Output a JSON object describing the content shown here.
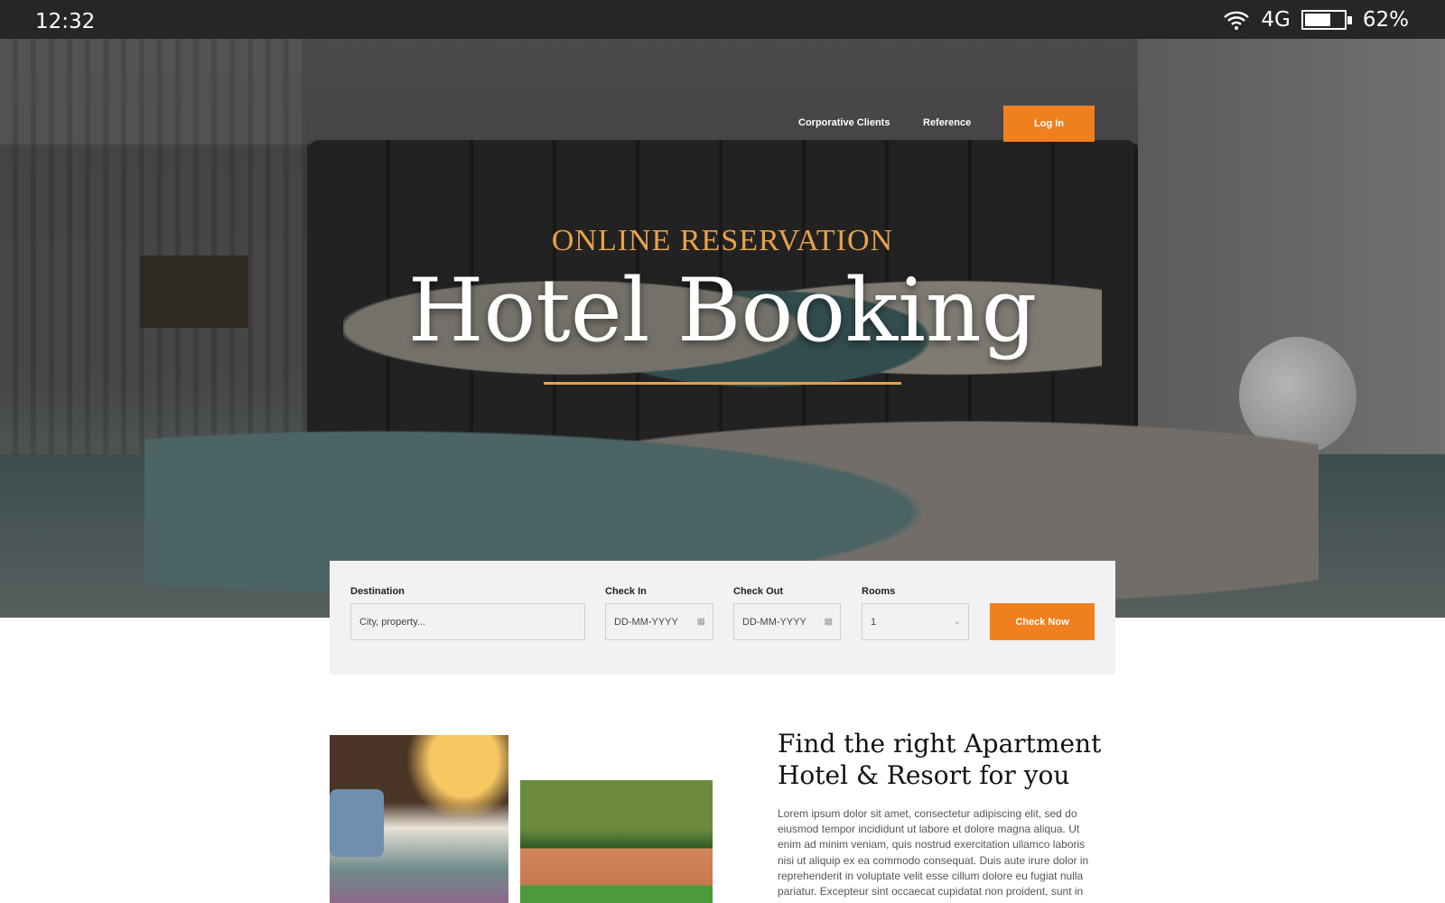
{
  "status_bar": {
    "time": "12:32",
    "network": "4G",
    "battery_percent": "62%",
    "battery_level": 0.62,
    "icons": [
      "wifi-icon",
      "battery-icon"
    ]
  },
  "nav": {
    "items": [
      "Corporative Clients",
      "Reference"
    ],
    "login": "Log In"
  },
  "hero": {
    "kicker": "ONLINE RESERVATION",
    "title": "Hotel Booking"
  },
  "booking": {
    "destination": {
      "label": "Destination",
      "placeholder": "City, property..."
    },
    "check_in": {
      "label": "Check In",
      "placeholder": "DD-MM-YYYY"
    },
    "check_out": {
      "label": "Check Out",
      "placeholder": "DD-MM-YYYY"
    },
    "rooms": {
      "label": "Rooms",
      "value": "1"
    },
    "submit": "Check Now"
  },
  "about": {
    "heading_line1": "Find the right Apartment",
    "heading_line2": "Hotel & Resort for you",
    "body": "Lorem ipsum dolor sit amet, consectetur adipiscing elit, sed do eiusmod tempor incididunt ut labore et dolore magna aliqua. Ut enim ad minim veniam, quis nostrud exercitation ullamco laboris nisi ut aliquip ex ea commodo consequat. Duis aute irure dolor in reprehenderit in voluptate velit esse cillum dolore eu fugiat nulla pariatur. Excepteur sint occaecat cupidatat non proident, sunt in"
  },
  "colors": {
    "accent": "#f0801f",
    "gold": "#e8a24a",
    "panel": "#f2f2f2"
  }
}
